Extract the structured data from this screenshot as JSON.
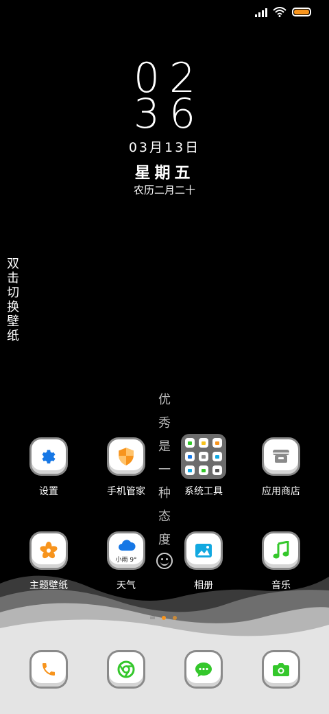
{
  "status_bar": {
    "battery_color": "#f7941d"
  },
  "lockclock": {
    "hour": "02",
    "minute": "36",
    "date": "03月13日",
    "weekday": "星期五",
    "lunar": "农历二月二十"
  },
  "side_hint": [
    "双",
    "击",
    "切",
    "换",
    "壁",
    "纸"
  ],
  "motto": [
    "优",
    "秀",
    "是",
    "一",
    "种",
    "态",
    "度"
  ],
  "apps": [
    {
      "label": "设置",
      "icon": "gear-icon",
      "color": "#1677e5"
    },
    {
      "label": "手机管家",
      "icon": "shield-icon",
      "color": "#f7941d"
    },
    {
      "label": "系统工具",
      "icon": "folder-icon",
      "color": "#6c6c6c"
    },
    {
      "label": "应用商店",
      "icon": "store-icon",
      "color": "#8a8a8a"
    },
    {
      "label": "主题壁纸",
      "icon": "flower-icon",
      "color": "#f7941d"
    },
    {
      "label": "天气",
      "icon": "cloud-icon",
      "color": "#1677e5",
      "weather_text": "小雨 9°"
    },
    {
      "label": "相册",
      "icon": "photo-icon",
      "color": "#12a8e0"
    },
    {
      "label": "音乐",
      "icon": "music-note-icon",
      "color": "#34c72b"
    }
  ],
  "dock": [
    {
      "icon": "phone-icon",
      "color": "#f7941d"
    },
    {
      "icon": "browser-icon",
      "color": "#34c72b"
    },
    {
      "icon": "message-icon",
      "color": "#34c72b"
    },
    {
      "icon": "camera-icon",
      "color": "#34c72b"
    }
  ],
  "page_indicator": {
    "pages": 2,
    "current": 1
  }
}
